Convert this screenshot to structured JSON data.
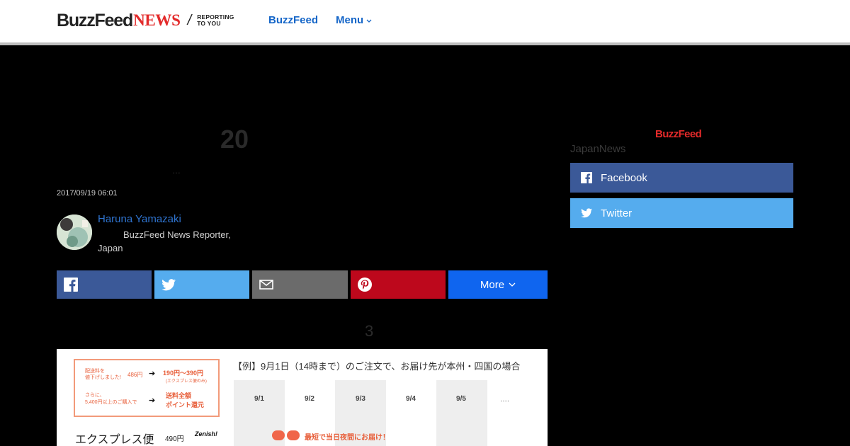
{
  "header": {
    "logo_buzzfeed": "BuzzFeed",
    "logo_news": "NEWS",
    "logo_slash": "/",
    "logo_tagline_1": "REPORTING",
    "logo_tagline_2": "TO YOU",
    "nav_buzzfeed": "BuzzFeed",
    "nav_menu": "Menu"
  },
  "article": {
    "headline_fragment": "20",
    "ellipsis": "…",
    "timestamp": "2017/09/19 06:01",
    "section_number": "3"
  },
  "author": {
    "name": "Haruna Yamazaki",
    "role": "BuzzFeed News Reporter, Japan"
  },
  "share_bar": {
    "more_label": "More",
    "buttons": [
      "facebook-icon",
      "twitter-icon",
      "mail-icon",
      "pinterest-icon"
    ]
  },
  "embed_image": {
    "promo_line_1": "配送料を",
    "promo_line_2": "値下げしました!",
    "promo_old_price": "486円",
    "promo_new_price": "190円〜390円",
    "promo_new_note": "(エクスプレス便のみ)",
    "promo_line_3": "さらに、",
    "promo_line_4": "5,400円以上のご購入で",
    "promo_free_1": "送料全額",
    "promo_free_2": "ポイント還元",
    "express_label": "エクスプレス便",
    "express_price": "490円",
    "express_logo": "Zenish!",
    "example_text": "【例】9月1日（14時まで）のご注文で、お届け先が本州・四国の場合",
    "dates": [
      "9/1",
      "9/2",
      "9/3",
      "9/4",
      "9/5"
    ],
    "dots": "….",
    "fast_text": "最短で当日夜間にお届け！"
  },
  "sidebar": {
    "logo": "BuzzFeed",
    "label": "JapanNews",
    "facebook_label": "Facebook",
    "twitter_label": "Twitter"
  },
  "colors": {
    "facebook": "#3b5998",
    "twitter": "#55acee",
    "mail": "#6b6b6b",
    "pinterest": "#bd081c",
    "more": "#0f65ef",
    "link_blue": "#1566c8",
    "brand_red": "#e32a2a"
  }
}
